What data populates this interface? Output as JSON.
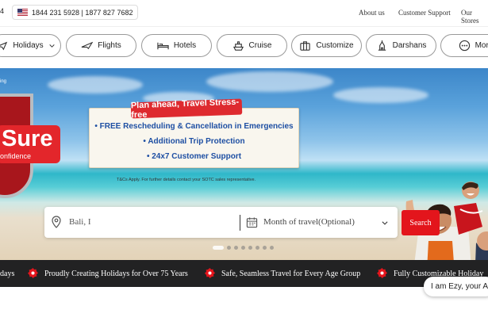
{
  "topbar": {
    "phone_fragment": "4",
    "phone_numbers": "1844 231 5928 | 1877 827 7682",
    "links": [
      "About us",
      "Customer Support",
      "Our Stores"
    ]
  },
  "nav": {
    "items": [
      {
        "label": "Holidays",
        "icon": "plane-icon"
      },
      {
        "label": "Flights",
        "icon": "plane-icon"
      },
      {
        "label": "Hotels",
        "icon": "bed-icon"
      },
      {
        "label": "Cruise",
        "icon": "ship-icon"
      },
      {
        "label": "Customize",
        "icon": "suitcase-icon"
      },
      {
        "label": "Darshans",
        "icon": "temple-icon"
      },
      {
        "label": "More",
        "icon": "more-icon"
      }
    ]
  },
  "hero": {
    "corner_text": "ing",
    "badge_word": "Sure",
    "badge_sub": "onfidence",
    "callout_heading": "Plan ahead, Travel Stress-free",
    "callout_lines": [
      "• FREE Rescheduling & Cancellation in Emergencies",
      "• Additional Trip Protection",
      "• 24x7 Customer Support"
    ],
    "disclaimer": "T&Cs Apply. For further details contact your SOTC sales representative.",
    "carousel": {
      "count": 8,
      "active": 0
    }
  },
  "search": {
    "destination_value": "Bali, I",
    "month_placeholder": "Month of travel(Optional)",
    "button_label": "Search"
  },
  "ticker": {
    "items": [
      "days",
      "Proudly Creating Holidays for Over 75 Years",
      "Safe, Seamless Travel for Every Age Group",
      "Fully Customizable Holiday"
    ]
  },
  "chat": {
    "text": "I am Ezy, your AI"
  },
  "colors": {
    "brand_red": "#e3151c",
    "ticker_bg": "#222223",
    "callout_blue": "#1e4fa3"
  }
}
